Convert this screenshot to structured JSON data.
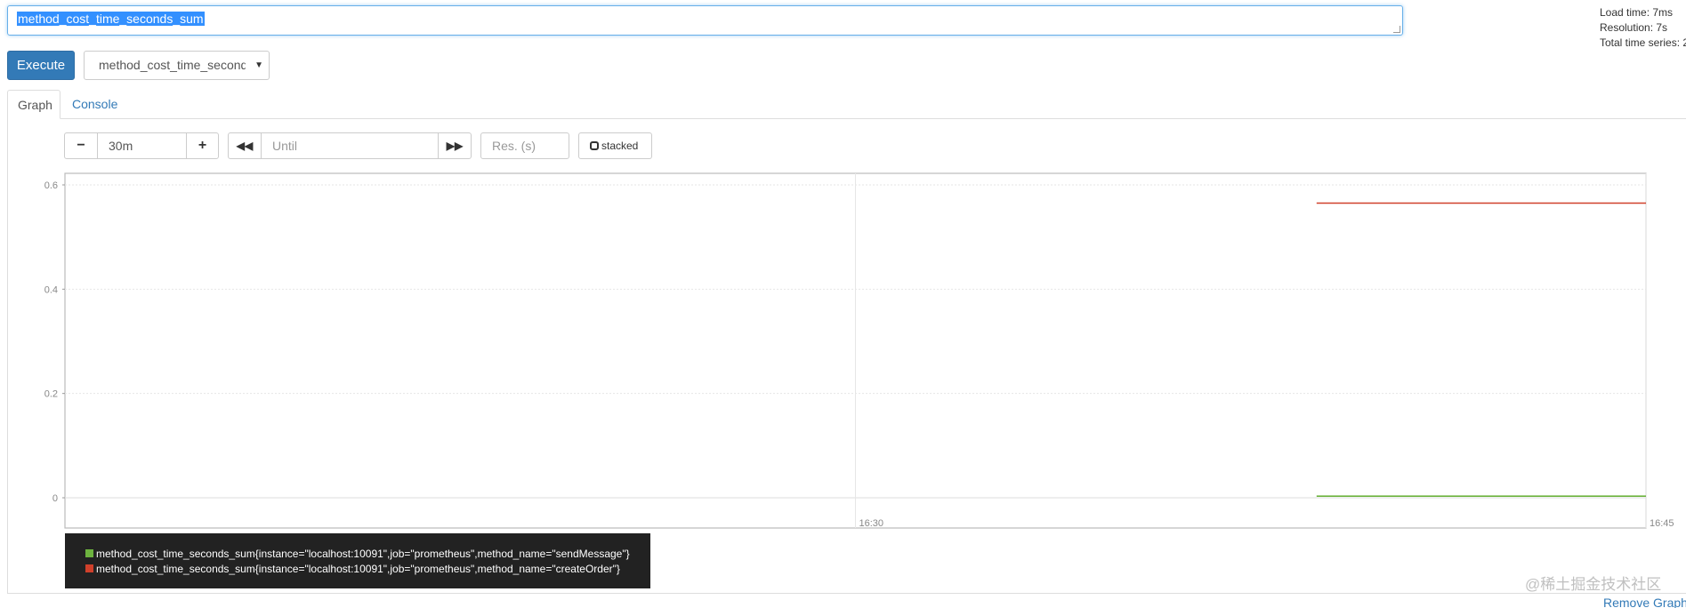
{
  "expression": {
    "value": "method_cost_time_seconds_sum"
  },
  "stats": {
    "load_time": "Load time: 7ms",
    "resolution": "Resolution: 7s",
    "total_series": "Total time series: 2"
  },
  "toolbar": {
    "execute_label": "Execute",
    "metric_select_value": "method_cost_time_seconds_sum"
  },
  "tabs": [
    {
      "label": "Graph",
      "active": true
    },
    {
      "label": "Console",
      "active": false
    }
  ],
  "controls": {
    "range_value": "30m",
    "until_placeholder": "Until",
    "resolution_placeholder": "Res. (s)",
    "stacked_label": "stacked",
    "minus_glyph": "−",
    "plus_glyph": "+",
    "back_glyph": "◀◀",
    "forward_glyph": "▶▶"
  },
  "chart_data": {
    "type": "line",
    "ylim": [
      0,
      0.6
    ],
    "y_ticks": [
      0,
      0.2,
      0.4,
      0.6
    ],
    "y_tick_labels": [
      "0",
      "0.2",
      "0.4",
      "0.6"
    ],
    "x_range": [
      "16:15",
      "16:45"
    ],
    "x_ticks": [
      "16:30",
      "16:45"
    ],
    "grid": true,
    "series": [
      {
        "name": "method_cost_time_seconds_sum{instance=\"localhost:10091\",job=\"prometheus\",method_name=\"sendMessage\"}",
        "color": "#6db33f",
        "x": [
          "16:38:45",
          "16:45"
        ],
        "values": [
          0.003,
          0.003
        ]
      },
      {
        "name": "method_cost_time_seconds_sum{instance=\"localhost:10091\",job=\"prometheus\",method_name=\"createOrder\"}",
        "color": "#d0402b",
        "x": [
          "16:38:45",
          "16:45"
        ],
        "values": [
          0.565,
          0.565
        ]
      }
    ]
  },
  "watermark": "@稀土掘金技术社区",
  "remove_graph_label": "Remove Graph",
  "colors": {
    "primary": "#337ab7",
    "legend_bg": "#222222"
  }
}
